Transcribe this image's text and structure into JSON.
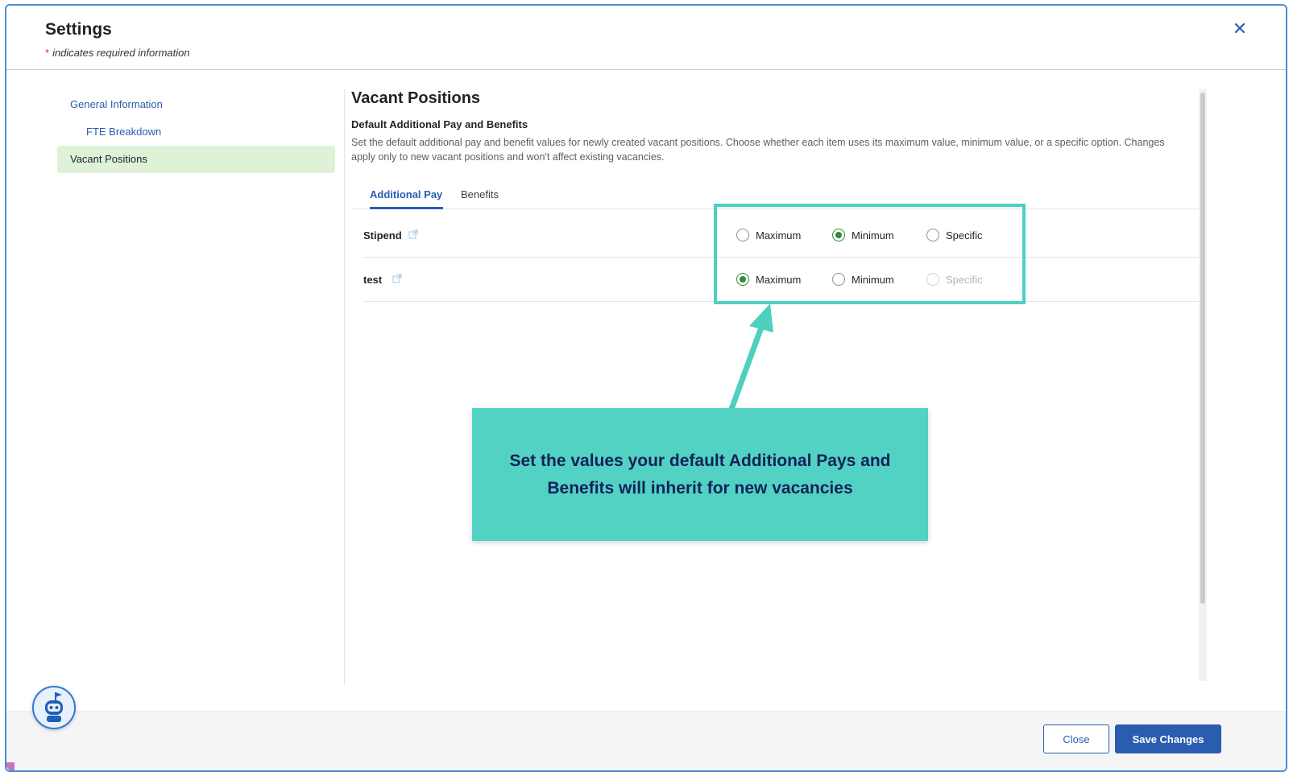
{
  "header": {
    "title": "Settings",
    "required_star": "*",
    "required_text": "indicates required information",
    "close_icon": "close-icon"
  },
  "sidebar": {
    "items": [
      {
        "label": "General Information",
        "level": 1,
        "active": false
      },
      {
        "label": "FTE Breakdown",
        "level": 2,
        "active": false
      },
      {
        "label": "Vacant Positions",
        "level": 1,
        "active": true
      }
    ]
  },
  "main": {
    "title": "Vacant Positions",
    "subtitle": "Default Additional Pay and Benefits",
    "description": "Set the default additional pay and benefit values for newly created vacant positions. Choose whether each item uses its maximum value, minimum value, or a specific option. Changes apply only to new vacant positions and won't affect existing vacancies.",
    "tabs": [
      {
        "label": "Additional Pay",
        "active": true
      },
      {
        "label": "Benefits",
        "active": false
      }
    ],
    "rows": [
      {
        "label": "Stipend",
        "options": [
          {
            "label": "Maximum",
            "checked": false,
            "disabled": false
          },
          {
            "label": "Minimum",
            "checked": true,
            "disabled": false
          },
          {
            "label": "Specific",
            "checked": false,
            "disabled": false
          }
        ]
      },
      {
        "label": "test",
        "options": [
          {
            "label": "Maximum",
            "checked": true,
            "disabled": false
          },
          {
            "label": "Minimum",
            "checked": false,
            "disabled": false
          },
          {
            "label": "Specific",
            "checked": false,
            "disabled": true
          }
        ]
      }
    ]
  },
  "callout": {
    "text": "Set the values your default Additional Pays and Benefits will inherit for new vacancies",
    "color": "#52d2c2",
    "text_color": "#14205a"
  },
  "footer": {
    "close_label": "Close",
    "save_label": "Save Changes"
  },
  "colors": {
    "accent": "#2a5db0",
    "radio_checked": "#2e8b3a",
    "sidebar_active": "#dff2d8",
    "highlight": "#4ecfc0"
  }
}
